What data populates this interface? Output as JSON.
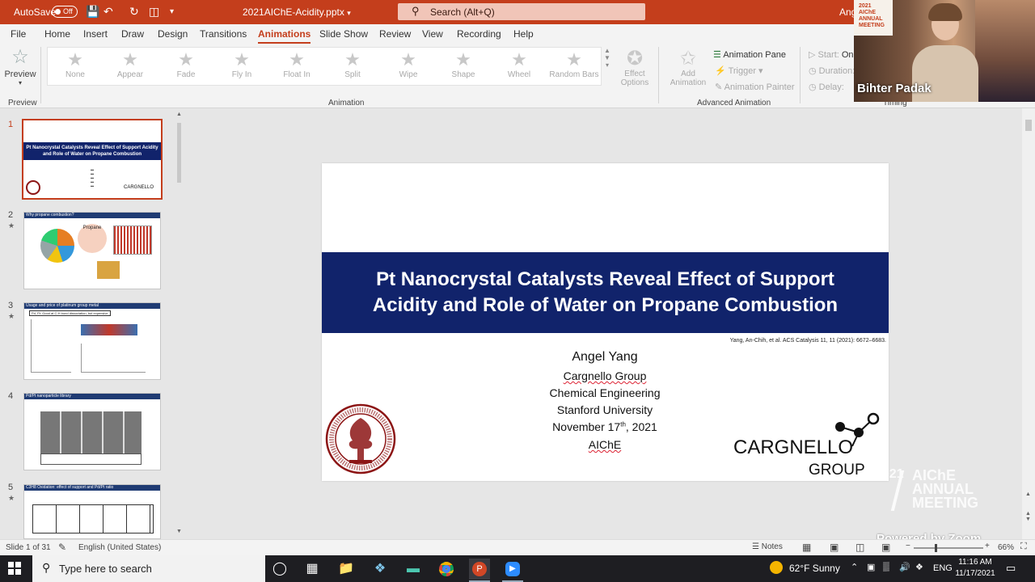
{
  "titlebar": {
    "autosave_label": "AutoSave",
    "autosave_state": "Off",
    "filename": "2021AIChE-Acidity.pptx",
    "search_placeholder": "Search (Alt+Q)",
    "user": "Ang"
  },
  "menu": {
    "tabs": [
      "File",
      "Home",
      "Insert",
      "Draw",
      "Design",
      "Transitions",
      "Animations",
      "Slide Show",
      "Review",
      "View",
      "Recording",
      "Help"
    ],
    "active": "Animations"
  },
  "ribbon": {
    "preview_label": "Preview",
    "preview_group": "Preview",
    "animations": [
      "None",
      "Appear",
      "Fade",
      "Fly In",
      "Float In",
      "Split",
      "Wipe",
      "Shape",
      "Wheel",
      "Random Bars"
    ],
    "effect_options_line1": "Effect",
    "effect_options_line2": "Options",
    "animation_group": "Animation",
    "add_animation_line1": "Add",
    "add_animation_line2": "Animation",
    "animation_pane": "Animation Pane",
    "trigger": "Trigger",
    "animation_painter": "Animation Painter",
    "advanced_group": "Advanced Animation",
    "start_label": "Start:",
    "start_value": "On",
    "duration_label": "Duration:",
    "delay_label": "Delay:",
    "timing_group": "Timing"
  },
  "thumbnails": [
    {
      "num": "1",
      "title": "Pt Nanocrystal Catalysts Reveal Effect of Support Acidity and Role of Water on Propane Combustion"
    },
    {
      "num": "2",
      "title": "Why propane combustion?",
      "label": "Propane"
    },
    {
      "num": "3",
      "title": "Usage and price of platinum group metal",
      "subtitle": "Pd, Pt: Good at C-H bond dissociation, but expensive"
    },
    {
      "num": "4",
      "title": "Pd/Pt nanoparticle library"
    },
    {
      "num": "5",
      "title": "C3H8 Oxidation: effect of support and Pd/Pt ratio"
    }
  ],
  "slide": {
    "title_line1": "Pt Nanocrystal Catalysts Reveal Effect of Support",
    "title_line2": "Acidity and Role of Water on Propane Combustion",
    "citation": "Yang, An-Chih, et al. ACS Catalysis 11, 11 (2021): 6672–6683.",
    "presenter": "Angel Yang",
    "group": "Cargnello Group",
    "dept": "Chemical Engineering",
    "university": "Stanford University",
    "date_prefix": "November 17",
    "date_sup": "th",
    "date_suffix": ", 2021",
    "event": "AIChE",
    "logo_line1": "CARGNELLO",
    "logo_line2": "GROUP"
  },
  "video": {
    "name": "Bihter Padak",
    "badge_line1": "2021",
    "badge_line2": "AIChE",
    "badge_line3": "ANNUAL",
    "badge_line4": "MEETING"
  },
  "watermark": {
    "year": "2021",
    "line1": "AIChE",
    "line2": "ANNUAL",
    "line3": "MEETING",
    "powered": "Powered by Zoom"
  },
  "statusbar": {
    "slide_info": "Slide 1 of 31",
    "language": "English (United States)",
    "notes": "Notes",
    "zoom": "66%"
  },
  "taskbar": {
    "search_placeholder": "Type here to search",
    "weather": "62°F  Sunny",
    "lang": "ENG",
    "time": "11:16 AM",
    "date": "11/17/2021"
  },
  "colors": {
    "accent": "#c43e1c",
    "slide_band": "#11236b",
    "stanford_red": "#8c1515"
  }
}
